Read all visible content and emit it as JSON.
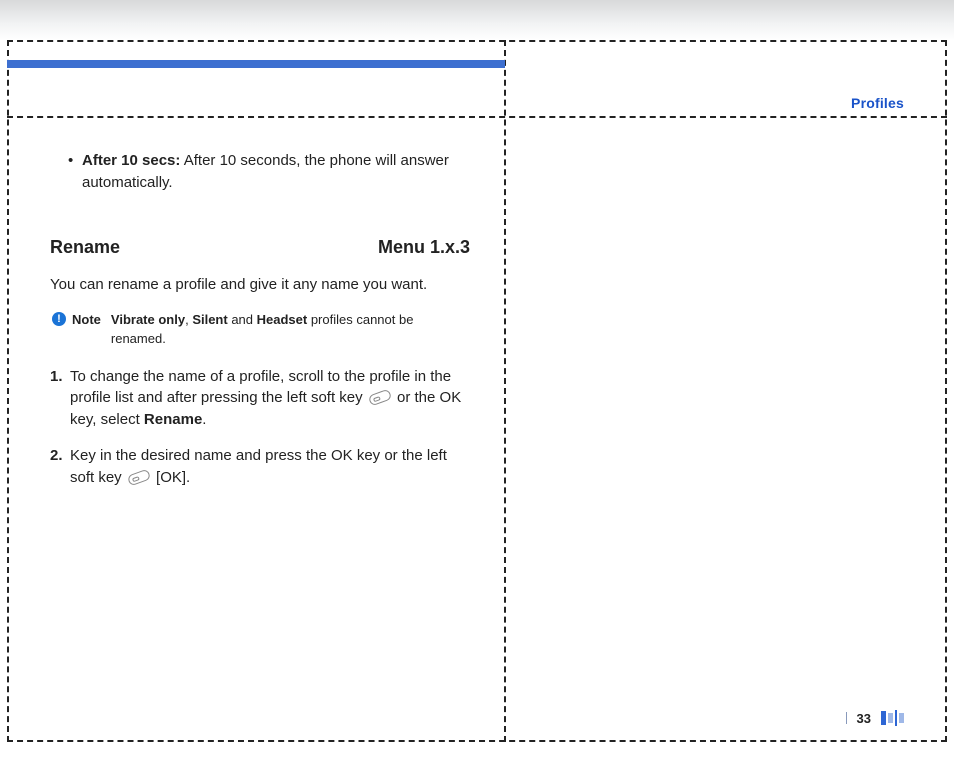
{
  "section_label": "Profiles",
  "bullet": {
    "label": "After 10 secs:",
    "text": " After 10 seconds, the phone will answer automatically."
  },
  "heading": {
    "title": "Rename",
    "menu": "Menu 1.x.3"
  },
  "intro": "You can rename a profile and give it any name you want.",
  "note": {
    "label": "Note",
    "b1": "Vibrate only",
    "t1": ", ",
    "b2": "Silent",
    "t2": " and ",
    "b3": "Headset",
    "t3": " profiles cannot be renamed."
  },
  "step1": {
    "num": "1.",
    "pre": "To change the name of a profile, scroll to the profile in the profile list and after pressing the left soft key ",
    "mid": " or the OK key, select ",
    "bold": "Rename",
    "post": "."
  },
  "step2": {
    "num": "2.",
    "pre": "Key in the desired name and press the OK key or the left soft key ",
    "post": " [OK]."
  },
  "page_number": "33"
}
